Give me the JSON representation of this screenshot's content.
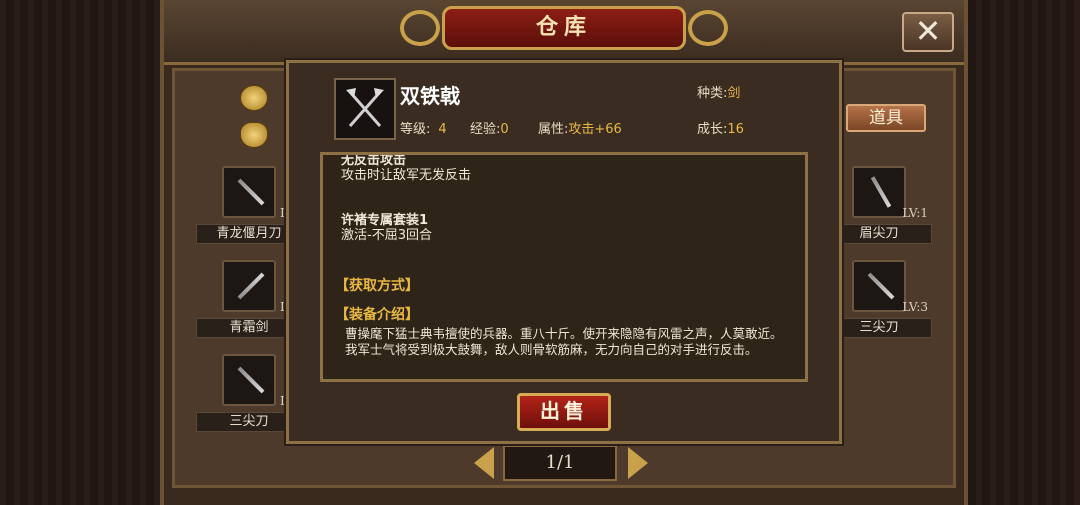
{
  "window": {
    "title": "仓库"
  },
  "tabs": {
    "props_label": "道具"
  },
  "inventory": {
    "left": [
      {
        "name": "青龙偃月刀",
        "level": "LV:"
      },
      {
        "name": "青霜剑",
        "level": "LV:"
      },
      {
        "name": "三尖刀",
        "level": "LV:"
      }
    ],
    "right": [
      {
        "name": "眉尖刀",
        "level": "LV:1"
      },
      {
        "name": "三尖刀",
        "level": "LV:3"
      }
    ]
  },
  "pager": {
    "text": "1/1"
  },
  "item": {
    "name": "双铁戟",
    "type_label": "种类:",
    "type_value": "剑",
    "level_label": "等级:",
    "level_value": "4",
    "exp_label": "经验:",
    "exp_value": "0",
    "attr_label": "属性:",
    "attr_value": "攻击+66",
    "growth_label": "成长:",
    "growth_value": "16"
  },
  "details": {
    "cut_title": "无反击攻击",
    "cut_text": "攻击时让敌军无发反击",
    "set_title": "许褚专属套装1",
    "set_text": "激活-不屈3回合",
    "obtain_heading": "【获取方式】",
    "intro_heading": "【装备介绍】",
    "intro_text": "曹操麾下猛士典韦擅使的兵器。重八十斤。使开来隐隐有风雷之声，人莫敢近。我军士气将受到极大鼓舞，敌人则骨软筋麻，无力向自己的对手进行反击。"
  },
  "actions": {
    "sell_label": "出售"
  },
  "colors": {
    "accent": "#e8b843",
    "panel": "#3a2c20",
    "sell": "#b3241a"
  }
}
